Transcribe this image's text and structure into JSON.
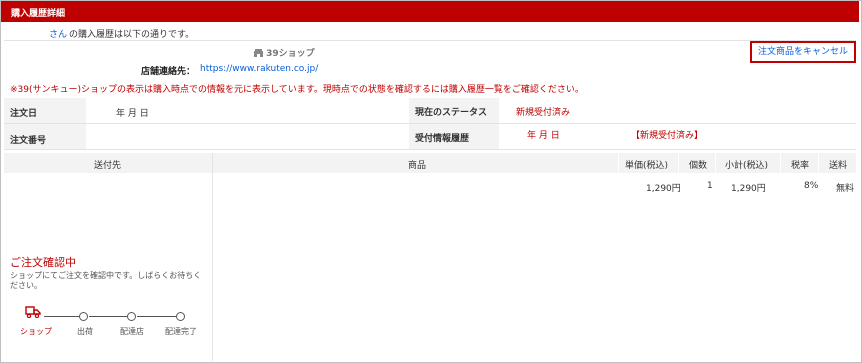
{
  "header": {
    "title": "購入履歴詳細"
  },
  "intro": {
    "user_link": "さん",
    "text": "の購入履歴は以下の通りです。"
  },
  "shop": {
    "icon": "shop-icon",
    "name": "39ショップ",
    "contact_label": "店舗連絡先：",
    "contact_url": "https://www.rakuten.co.jp/",
    "notice": "※39(サンキュー)ショップの表示は購入時点での情報を元に表示しています。現時点での状態を確認するには購入履歴一覧をご確認ください。"
  },
  "cancel_button": "注文商品をキャンセル",
  "order": {
    "date_label": "注文日",
    "date_value": "年 月 日",
    "number_label": "注文番号",
    "number_value": "",
    "status_label": "現在のステータス",
    "status_value": "新規受付済み",
    "history_label": "受付情報履歴",
    "history_date": "年 月 日",
    "history_status": "【新規受付済み】"
  },
  "table": {
    "headers": {
      "ship_to": "送付先",
      "product": "商品",
      "unit_price": "単価(税込)",
      "qty": "個数",
      "subtotal": "小計(税込)",
      "tax_rate": "税率",
      "shipping": "送料"
    },
    "row": {
      "unit_price": "1,290円",
      "qty": "1",
      "subtotal": "1,290円",
      "tax_rate": "8%",
      "shipping": "無料"
    }
  },
  "progress": {
    "title": "ご注文確認中",
    "description_line1": "ショップにてご注文を確認中です。しばらくお待ちく",
    "description_line2": "ださい。",
    "current_step": 1,
    "steps": [
      {
        "label": "ショップ"
      },
      {
        "label": "出荷"
      },
      {
        "label": "配達店"
      },
      {
        "label": "配達完了"
      }
    ]
  },
  "colors": {
    "brand_red": "#bf0000",
    "link_blue": "#0b5ed7"
  }
}
